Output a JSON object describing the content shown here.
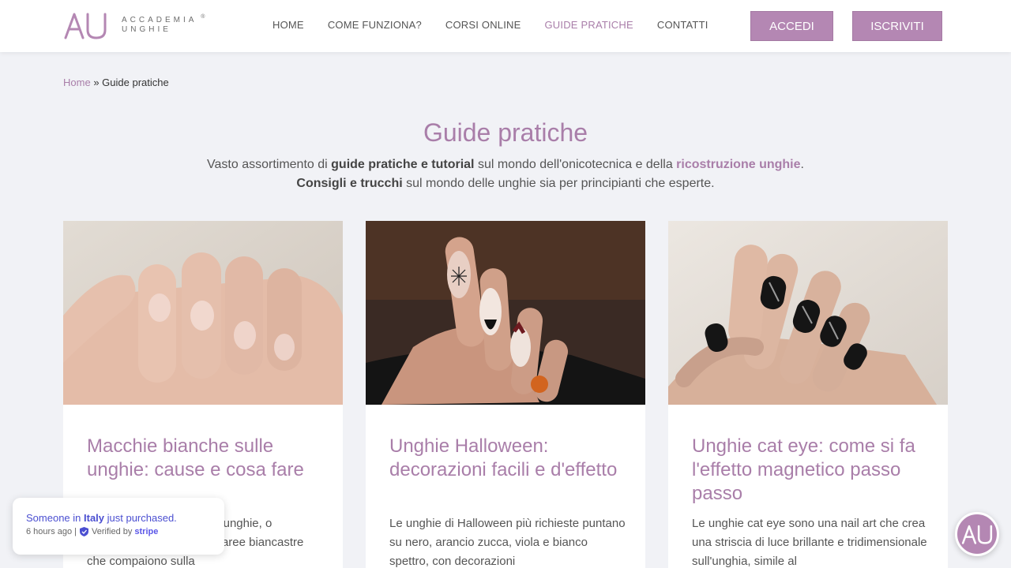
{
  "brand": {
    "logo_mark": "AU",
    "line1": "ACCADEMIA",
    "line2": "UNGHIE",
    "reg": "®"
  },
  "nav": [
    {
      "label": "HOME",
      "active": false
    },
    {
      "label": "COME FUNZIONA?",
      "active": false
    },
    {
      "label": "CORSI ONLINE",
      "active": false
    },
    {
      "label": "GUIDE PRATICHE",
      "active": true
    },
    {
      "label": "CONTATTI",
      "active": false
    }
  ],
  "buttons": {
    "login": "ACCEDI",
    "register": "ISCRIVITI"
  },
  "breadcrumb": {
    "home": "Home",
    "separator": "»",
    "current": "Guide pratiche"
  },
  "page": {
    "title": "Guide pratiche",
    "intro_1": "Vasto assortimento di ",
    "intro_b1": "guide pratiche e tutorial",
    "intro_2": " sul mondo dell'onicotecnica e della ",
    "intro_hl": "ricostruzione unghie",
    "intro_3": ". ",
    "intro_b2": "Consigli e trucchi",
    "intro_4": " sul mondo delle unghie sia per principianti che esperte."
  },
  "cards": [
    {
      "title": "Macchie bianche sulle unghie: cause e cosa fare",
      "excerpt": "Le macchie bianche sulle unghie, o leuconichia, sono piccole aree biancastre che compaiono sulla",
      "image": "hand-natural-nails"
    },
    {
      "title": "Unghie Halloween: decorazioni facili e d'effetto",
      "excerpt": "Le unghie di Halloween più richieste puntano su nero, arancio zucca, viola e bianco spettro, con decorazioni",
      "image": "hand-halloween-nails"
    },
    {
      "title": "Unghie cat eye: come si fa l'effetto magnetico passo passo",
      "excerpt": "Le unghie cat eye sono una nail art che crea una striscia di luce brillante e tridimensionale sull'unghia, simile al",
      "image": "hand-black-cat-eye-nails"
    }
  ],
  "toast": {
    "pre": "Someone in ",
    "place": "Italy",
    "post": " just purchased.",
    "time": "6 hours ago |",
    "verified": "Verified by",
    "provider": "stripe"
  },
  "colors": {
    "accent": "#a97ea9",
    "button": "#b487b3",
    "background": "#f1f2f6",
    "toast_text": "#4b4fd1"
  }
}
